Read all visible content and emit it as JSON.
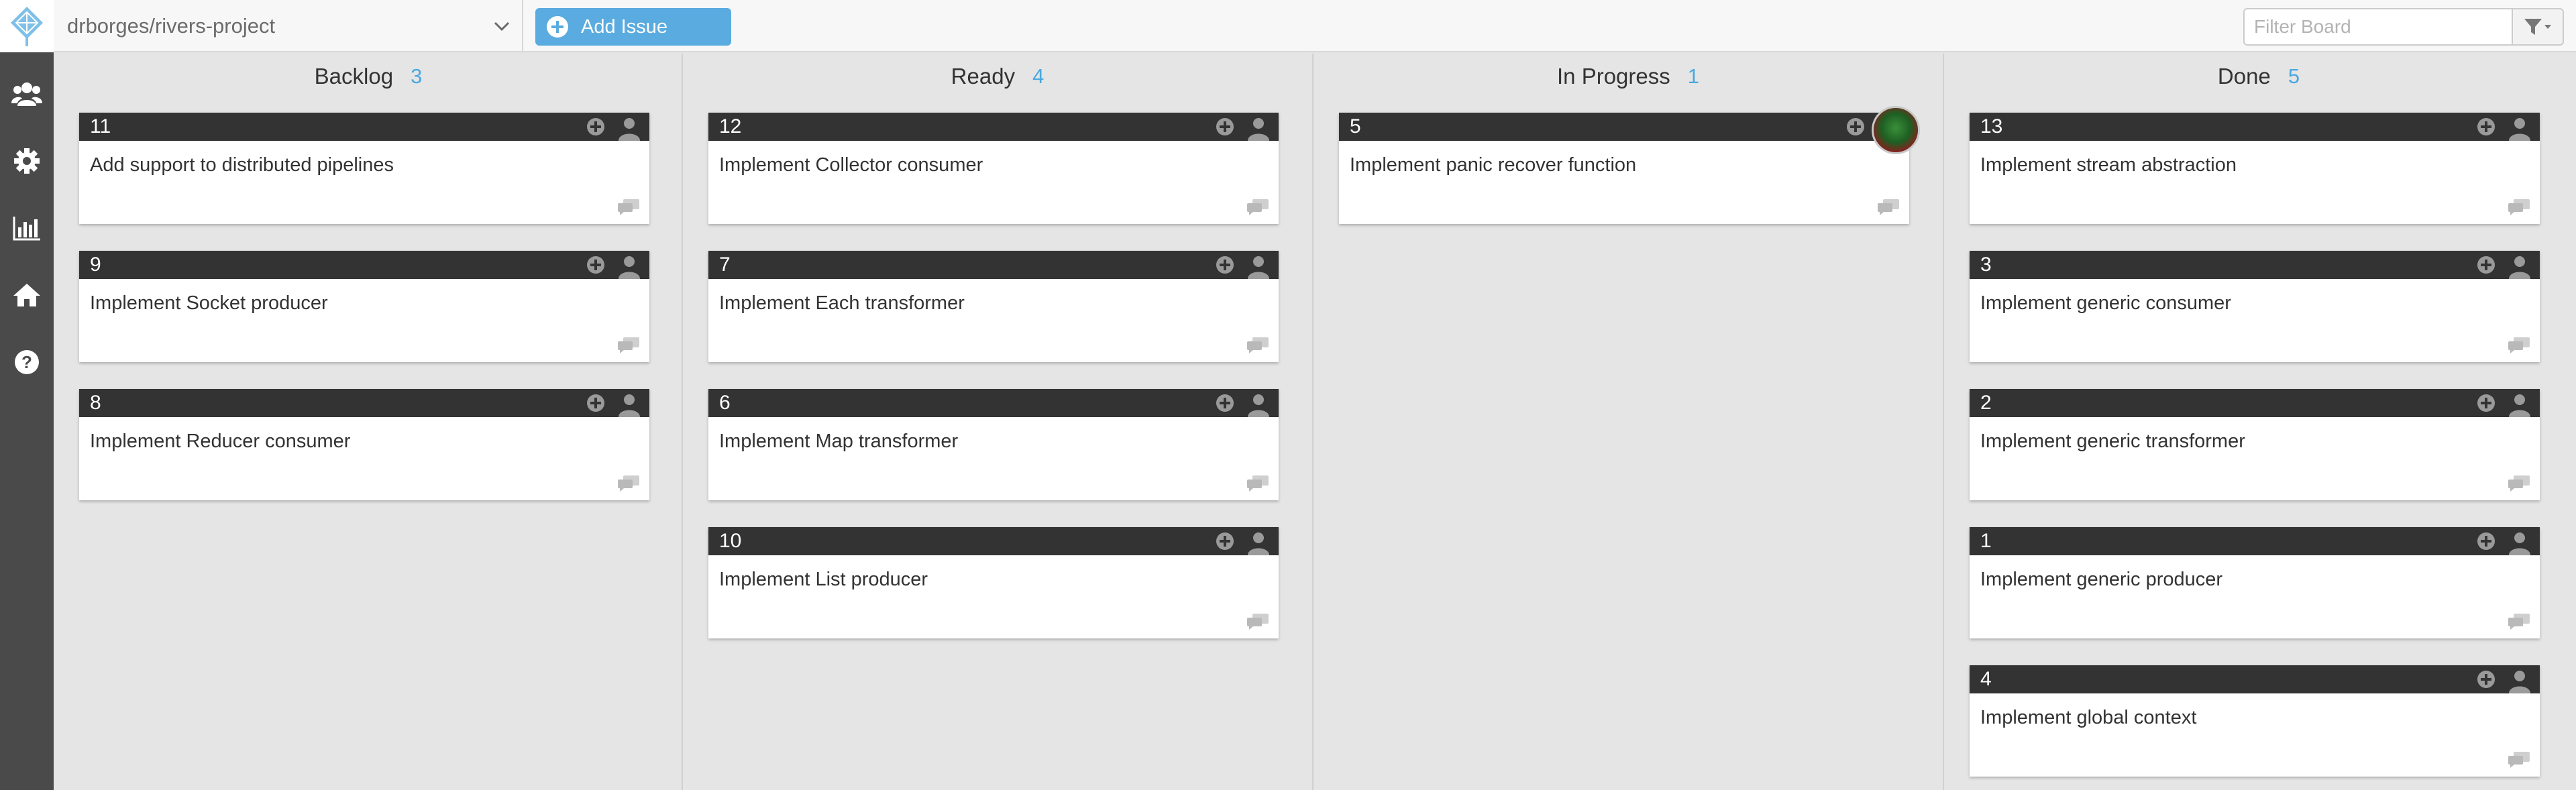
{
  "repo": {
    "name": "drborges/rivers-project"
  },
  "toolbar": {
    "add_issue_label": "Add Issue"
  },
  "filter": {
    "placeholder": "Filter Board"
  },
  "sidebar": {
    "logo_icon": "diamond-logo-icon",
    "items": [
      {
        "icon": "users-icon"
      },
      {
        "icon": "gear-icon"
      },
      {
        "icon": "chart-icon"
      },
      {
        "icon": "home-icon"
      },
      {
        "icon": "help-icon"
      }
    ]
  },
  "colors": {
    "accent": "#5aabdf",
    "sidebar": "#4a4a4a",
    "card_header": "#333333",
    "count": "#4aa8e0"
  },
  "columns": [
    {
      "title": "Backlog",
      "count": "3",
      "cards": [
        {
          "number": "11",
          "title": "Add support to distributed pipelines"
        },
        {
          "number": "9",
          "title": "Implement Socket producer"
        },
        {
          "number": "8",
          "title": "Implement Reducer consumer"
        }
      ]
    },
    {
      "title": "Ready",
      "count": "4",
      "cards": [
        {
          "number": "12",
          "title": "Implement Collector consumer"
        },
        {
          "number": "7",
          "title": "Implement Each transformer"
        },
        {
          "number": "6",
          "title": "Implement Map transformer"
        },
        {
          "number": "10",
          "title": "Implement List producer"
        }
      ]
    },
    {
      "title": "In Progress",
      "count": "1",
      "cards": [
        {
          "number": "5",
          "title": "Implement panic recover function",
          "assigned": true
        }
      ]
    },
    {
      "title": "Done",
      "count": "5",
      "cards": [
        {
          "number": "13",
          "title": "Implement stream abstraction"
        },
        {
          "number": "3",
          "title": "Implement generic consumer"
        },
        {
          "number": "2",
          "title": "Implement generic transformer"
        },
        {
          "number": "1",
          "title": "Implement generic producer"
        },
        {
          "number": "4",
          "title": "Implement global context"
        }
      ]
    }
  ]
}
